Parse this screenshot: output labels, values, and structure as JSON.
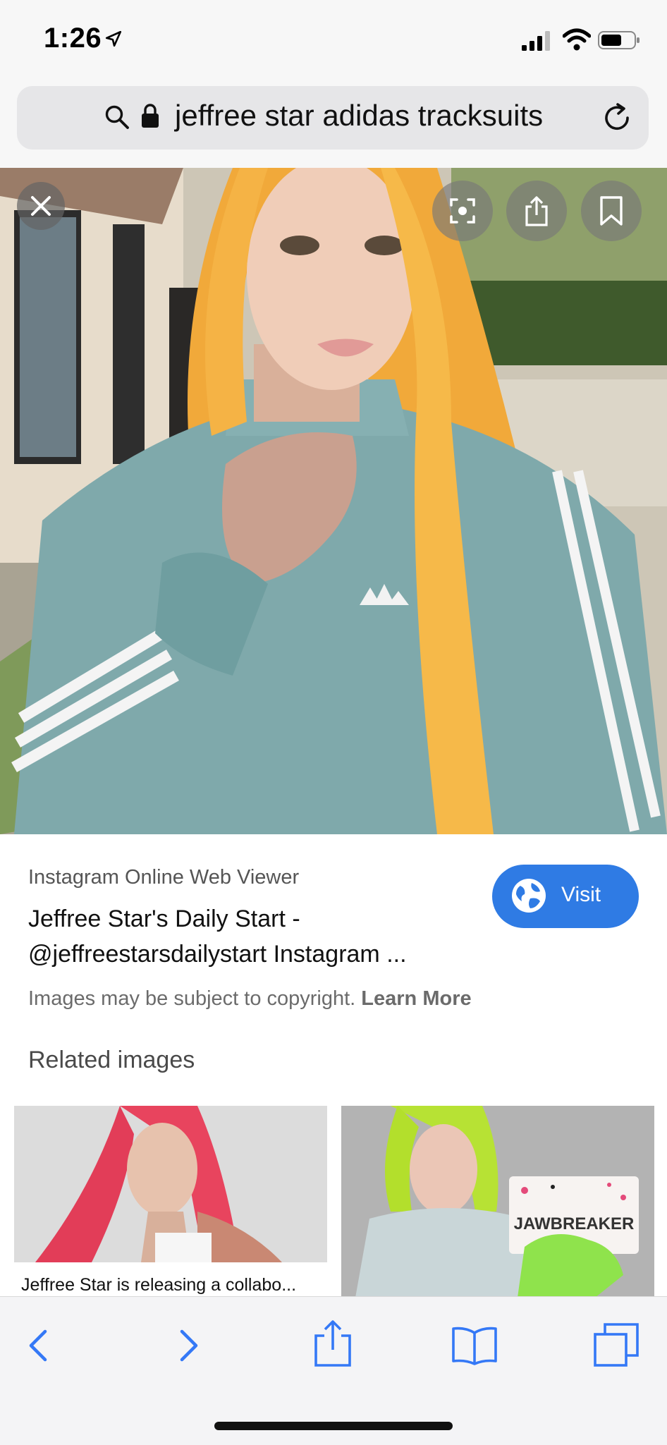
{
  "status_bar": {
    "time": "1:26"
  },
  "url_bar": {
    "query": "jeffree star adidas tracksuits"
  },
  "result": {
    "source": "Instagram Online Web Viewer",
    "title": "Jeffree Star's Daily Start - @jeffreestarsdailystart Instagram ...",
    "visit_label": "Visit",
    "copyright_text": "Images may be subject to copyright.",
    "learn_more": "Learn More"
  },
  "related": {
    "heading": "Related images",
    "items": [
      {
        "caption": "Jeffree Star is releasing a collabo..."
      },
      {
        "box_text": "JAWBREAKER"
      }
    ]
  },
  "colors": {
    "accent": "#2f7be4",
    "toolbar_icon": "#3478f6"
  },
  "icons": [
    "location-arrow-icon",
    "signal-icon",
    "wifi-icon",
    "battery-icon",
    "search-icon",
    "lock-icon",
    "reload-icon",
    "close-icon",
    "visual-lookup-icon",
    "share-icon",
    "bookmark-icon",
    "globe-icon",
    "back-icon",
    "forward-icon",
    "bookmarks-icon",
    "tabs-icon"
  ]
}
